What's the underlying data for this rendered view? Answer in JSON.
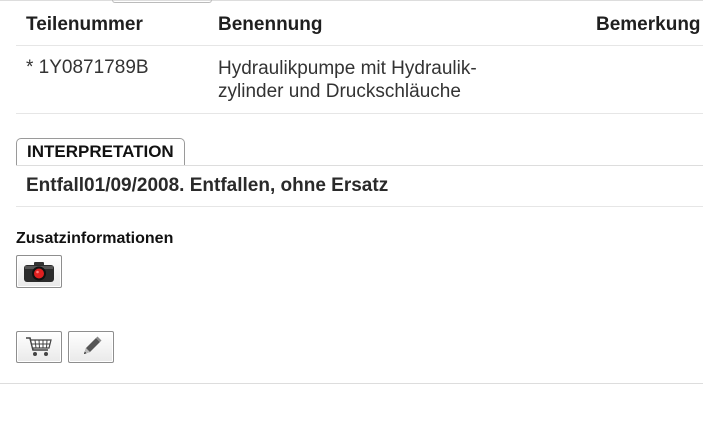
{
  "table": {
    "headers": {
      "part_number": "Teilenummer",
      "name": "Benennung",
      "remark": "Bemerkung"
    },
    "rows": [
      {
        "part_number": "* 1Y0871789B",
        "name": "Hydraulikpumpe mit Hydraulik- zylinder und Druckschläuche",
        "remark": ""
      }
    ]
  },
  "interpretation": {
    "tab_label": "INTERPRETATION",
    "text": "Entfall01/09/2008. Entfallen, ohne Ersatz"
  },
  "additional_info": {
    "title": "Zusatzinformationen"
  },
  "icons": {
    "camera": "camera-icon",
    "cart": "shopping-cart-icon",
    "edit": "pencil-icon"
  },
  "colors": {
    "camera_lens": "#e02020",
    "button_border": "#8e8e8e"
  }
}
